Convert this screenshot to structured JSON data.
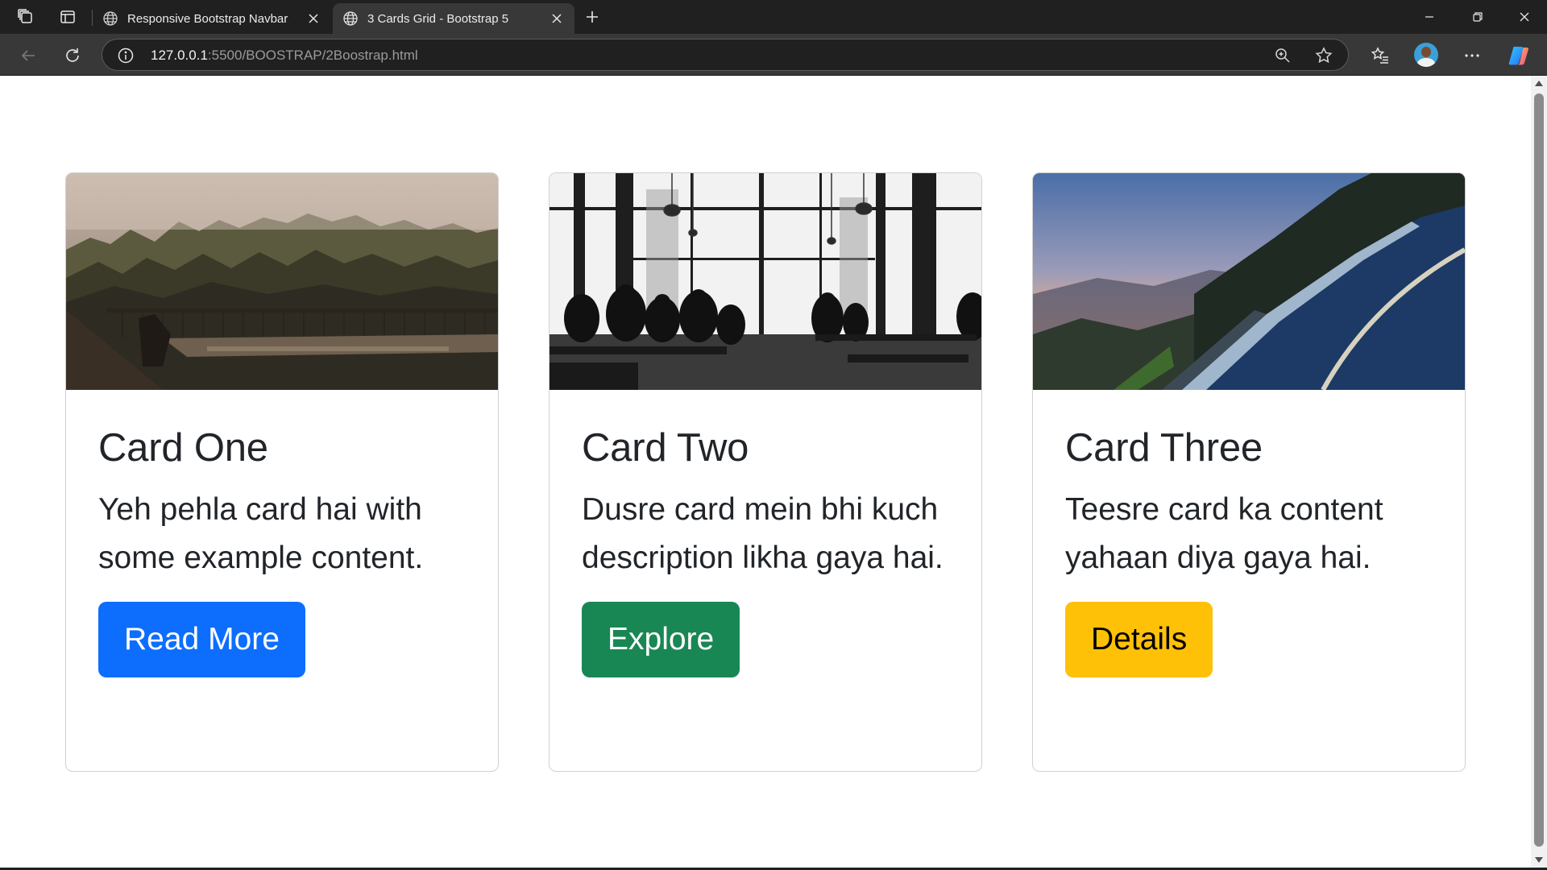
{
  "browser": {
    "tabs": [
      {
        "title": "Responsive Bootstrap Navbar",
        "active": false
      },
      {
        "title": "3 Cards Grid - Bootstrap 5",
        "active": true
      }
    ],
    "url_host": "127.0.0.1",
    "url_rest": ":5500/BOOSTRAP/2Boostrap.html"
  },
  "cards": [
    {
      "title": "Card One",
      "text": "Yeh pehla card hai with some example content.",
      "button": "Read More",
      "button_color": "#0d6efd",
      "image": "misty-forest-balcony"
    },
    {
      "title": "Card Two",
      "text": "Dusre card mein bhi kuch description likha gaya hai.",
      "button": "Explore",
      "button_color": "#198754",
      "image": "cafe-silhouette-bw"
    },
    {
      "title": "Card Three",
      "text": "Teesre card ka content yahaan diya gaya hai.",
      "button": "Details",
      "button_color": "#ffc107",
      "image": "mountain-road-sunset"
    }
  ]
}
